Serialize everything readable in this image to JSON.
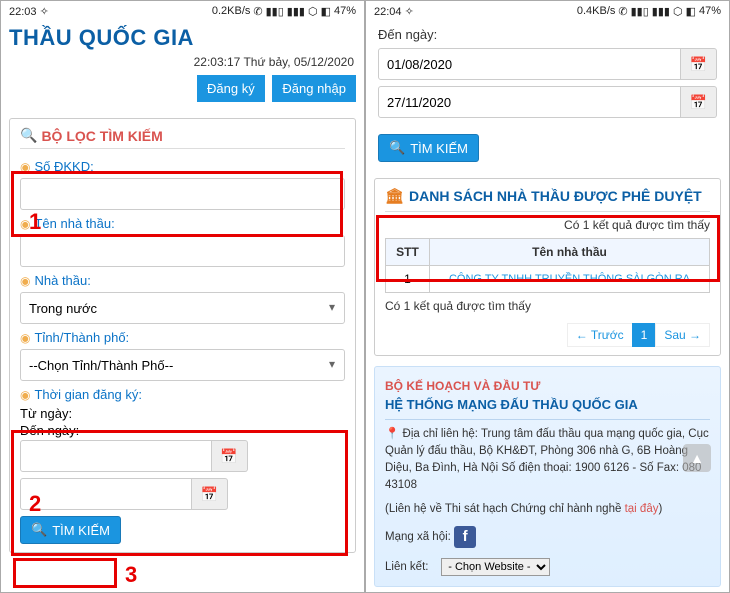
{
  "left": {
    "statusbar": {
      "time": "22:03",
      "speed": "0.2KB/s",
      "battery": "47%"
    },
    "app_title": "THẦU QUỐC GIA",
    "datetime": "22:03:17 Thứ bảy, 05/12/2020",
    "btn_register": "Đăng ký",
    "btn_login": "Đăng nhập",
    "filter_header": "BỘ LỌC TÌM KIẾM",
    "lbl_so_dkkd": "Số ĐKKD:",
    "lbl_ten": "Tên nhà thầu:",
    "lbl_nhathau": "Nhà thầu:",
    "nhathau_option": "Trong nước",
    "lbl_tinh": "Tỉnh/Thành phố:",
    "tinh_option": "--Chọn Tỉnh/Thành Phố--",
    "lbl_thoigian": "Thời gian đăng ký:",
    "lbl_tungay": "Từ ngày:",
    "lbl_denngay": "Đến ngày:",
    "btn_search": "TÌM KIẾM",
    "anno1": "1",
    "anno2": "2",
    "anno3": "3"
  },
  "right": {
    "statusbar": {
      "time": "22:04",
      "speed": "0.4KB/s",
      "battery": "47%"
    },
    "lbl_denngay": "Đến ngày:",
    "date1": "01/08/2020",
    "date2": "27/11/2020",
    "btn_search": "TÌM KIẾM",
    "results_header": "DANH SÁCH NHÀ THẦU ĐƯỢC PHÊ DUYỆT",
    "results_found": "Có 1 kết quả được tìm thấy",
    "col_stt": "STT",
    "col_ten": "Tên nhà thầu",
    "row_idx": "1",
    "row_name": "CÔNG TY TNHH TRUYỀN THÔNG SÀI GÒN RA",
    "pager_prev": "← Trước",
    "pager_page": "1",
    "pager_next": "Sau →",
    "footer": {
      "line_red": "BỘ KẾ HOẠCH VÀ ĐẦU TƯ",
      "line_blue": "HỆ THỐNG MẠNG ĐẤU THẦU QUỐC GIA",
      "addr": "Địa chỉ liên hệ: Trung tâm đấu thầu qua mạng quốc gia, Cục Quản lý đấu thầu, Bộ KH&ĐT, Phòng 306 nhà G, 6B Hoàng Diệu, Ba Đình, Hà Nội Số điện thoại: 1900 6126 - Số Fax: 080 43108",
      "contact_prefix": "(Liên hệ về Thi sát hạch Chứng chỉ hành nghề ",
      "contact_link": "tại đây",
      "contact_suffix": ")",
      "social_label": "Mạng xã hội:",
      "link_label": "Liên kết:",
      "website_option": "- Chọn Website -"
    }
  }
}
